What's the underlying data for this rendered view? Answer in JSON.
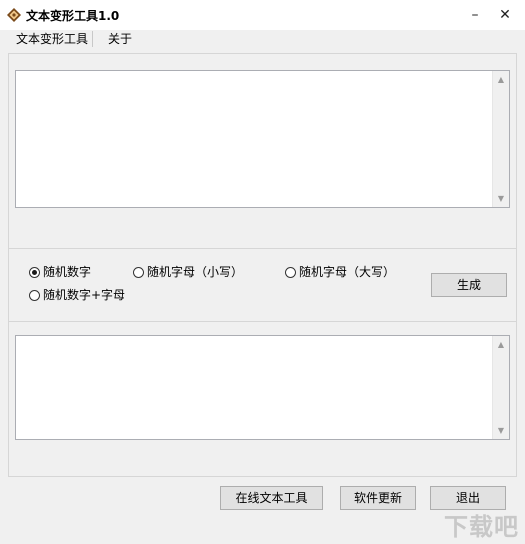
{
  "window": {
    "title": "文本变形工具1.0",
    "minimize": "–",
    "close": "✕"
  },
  "menu": {
    "items": [
      "文本变形工具",
      "关于"
    ]
  },
  "options": {
    "random_digits": "随机数字",
    "random_lower": "随机字母（小写）",
    "random_upper": "随机字母（大写）",
    "random_digits_letters": "随机数字+字母",
    "selected": "随机数字"
  },
  "buttons": {
    "generate": "生成",
    "online_tools": "在线文本工具",
    "update": "软件更新",
    "exit": "退出"
  },
  "input_text": "",
  "output_text": "",
  "watermark": "下载吧"
}
